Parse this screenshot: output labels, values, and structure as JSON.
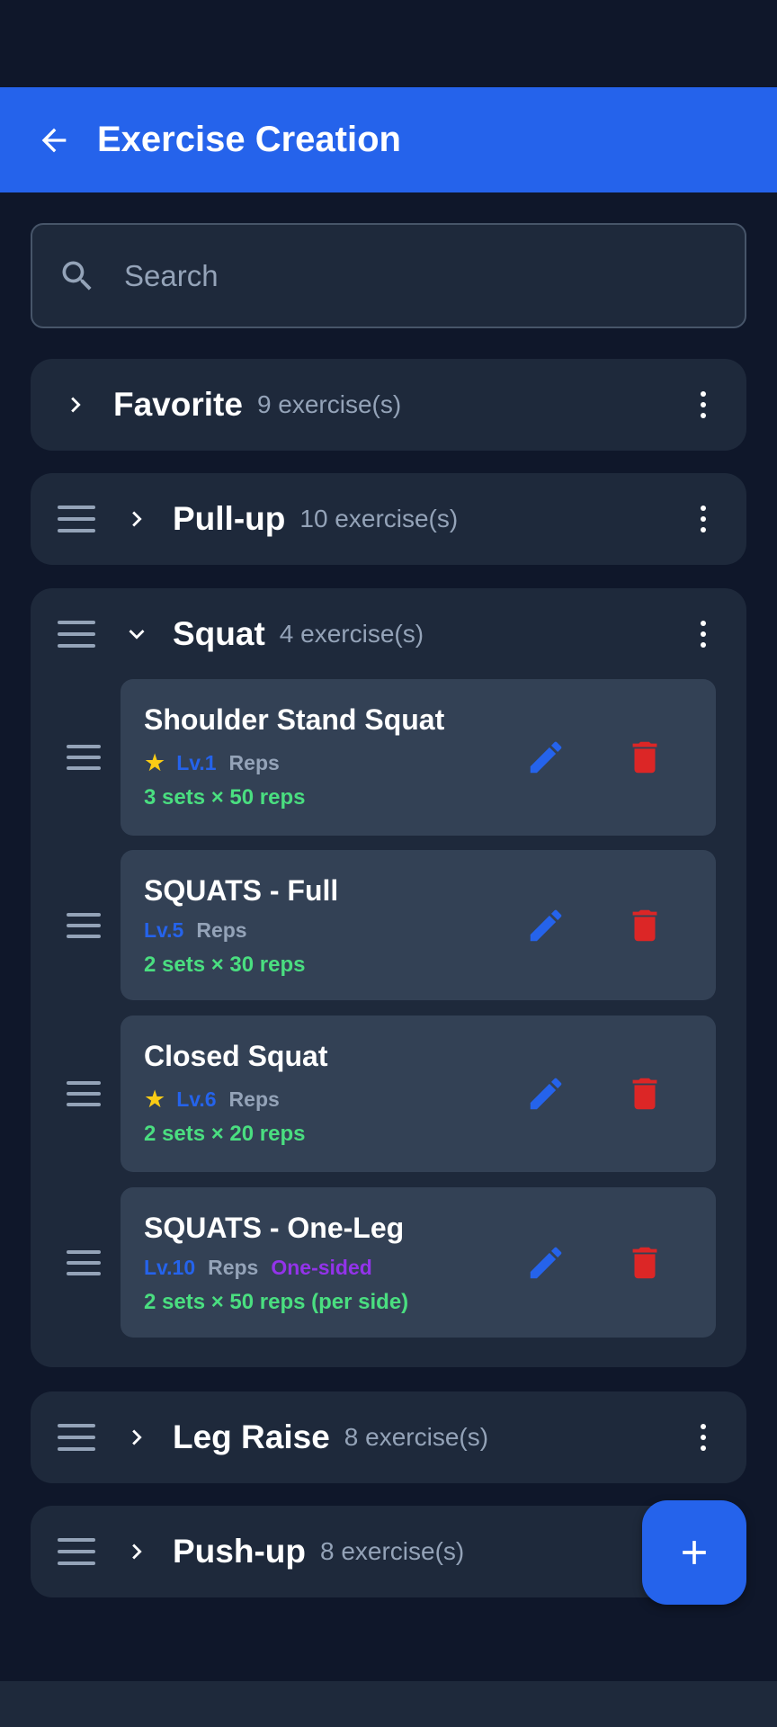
{
  "app_bar": {
    "title": "Exercise Creation"
  },
  "search": {
    "placeholder": "Search"
  },
  "categories": [
    {
      "name": "Favorite",
      "count": "9 exercise(s)",
      "expanded": false,
      "draggable": false
    },
    {
      "name": "Pull-up",
      "count": "10 exercise(s)",
      "expanded": false,
      "draggable": true
    },
    {
      "name": "Squat",
      "count": "4 exercise(s)",
      "expanded": true,
      "draggable": true
    },
    {
      "name": "Leg Raise",
      "count": "8 exercise(s)",
      "expanded": false,
      "draggable": true
    },
    {
      "name": "Push-up",
      "count": "8 exercise(s)",
      "expanded": false,
      "draggable": true
    }
  ],
  "squat_exercises": [
    {
      "name": "Shoulder Stand Squat",
      "favorite": true,
      "level": "Lv.1",
      "type": "Reps",
      "extra": "",
      "sets": "3 sets × 50 reps"
    },
    {
      "name": "SQUATS - Full",
      "favorite": false,
      "level": "Lv.5",
      "type": "Reps",
      "extra": "",
      "sets": "2 sets × 30 reps"
    },
    {
      "name": "Closed Squat",
      "favorite": true,
      "level": "Lv.6",
      "type": "Reps",
      "extra": "",
      "sets": "2 sets × 20 reps"
    },
    {
      "name": "SQUATS - One-Leg",
      "favorite": false,
      "level": "Lv.10",
      "type": "Reps",
      "extra": "One-sided",
      "sets": "2 sets × 50 reps (per side)"
    }
  ],
  "icons": {
    "back": "arrow-left-icon",
    "search": "magnifier-icon",
    "drag": "drag-handle-icon",
    "expand": "chevron-right-icon",
    "collapse": "chevron-down-icon",
    "more": "kebab-icon",
    "edit": "pencil-icon",
    "delete": "trash-icon",
    "star": "star-icon",
    "add": "plus-icon"
  },
  "colors": {
    "background": "#0f172a",
    "surface": "#1e293b",
    "surface_inner": "#334155",
    "accent": "#2563eb",
    "delete": "#dc2626",
    "sets": "#4ade80",
    "star": "#facc15",
    "one_sided": "#9333ea",
    "muted": "#94a3b8"
  }
}
